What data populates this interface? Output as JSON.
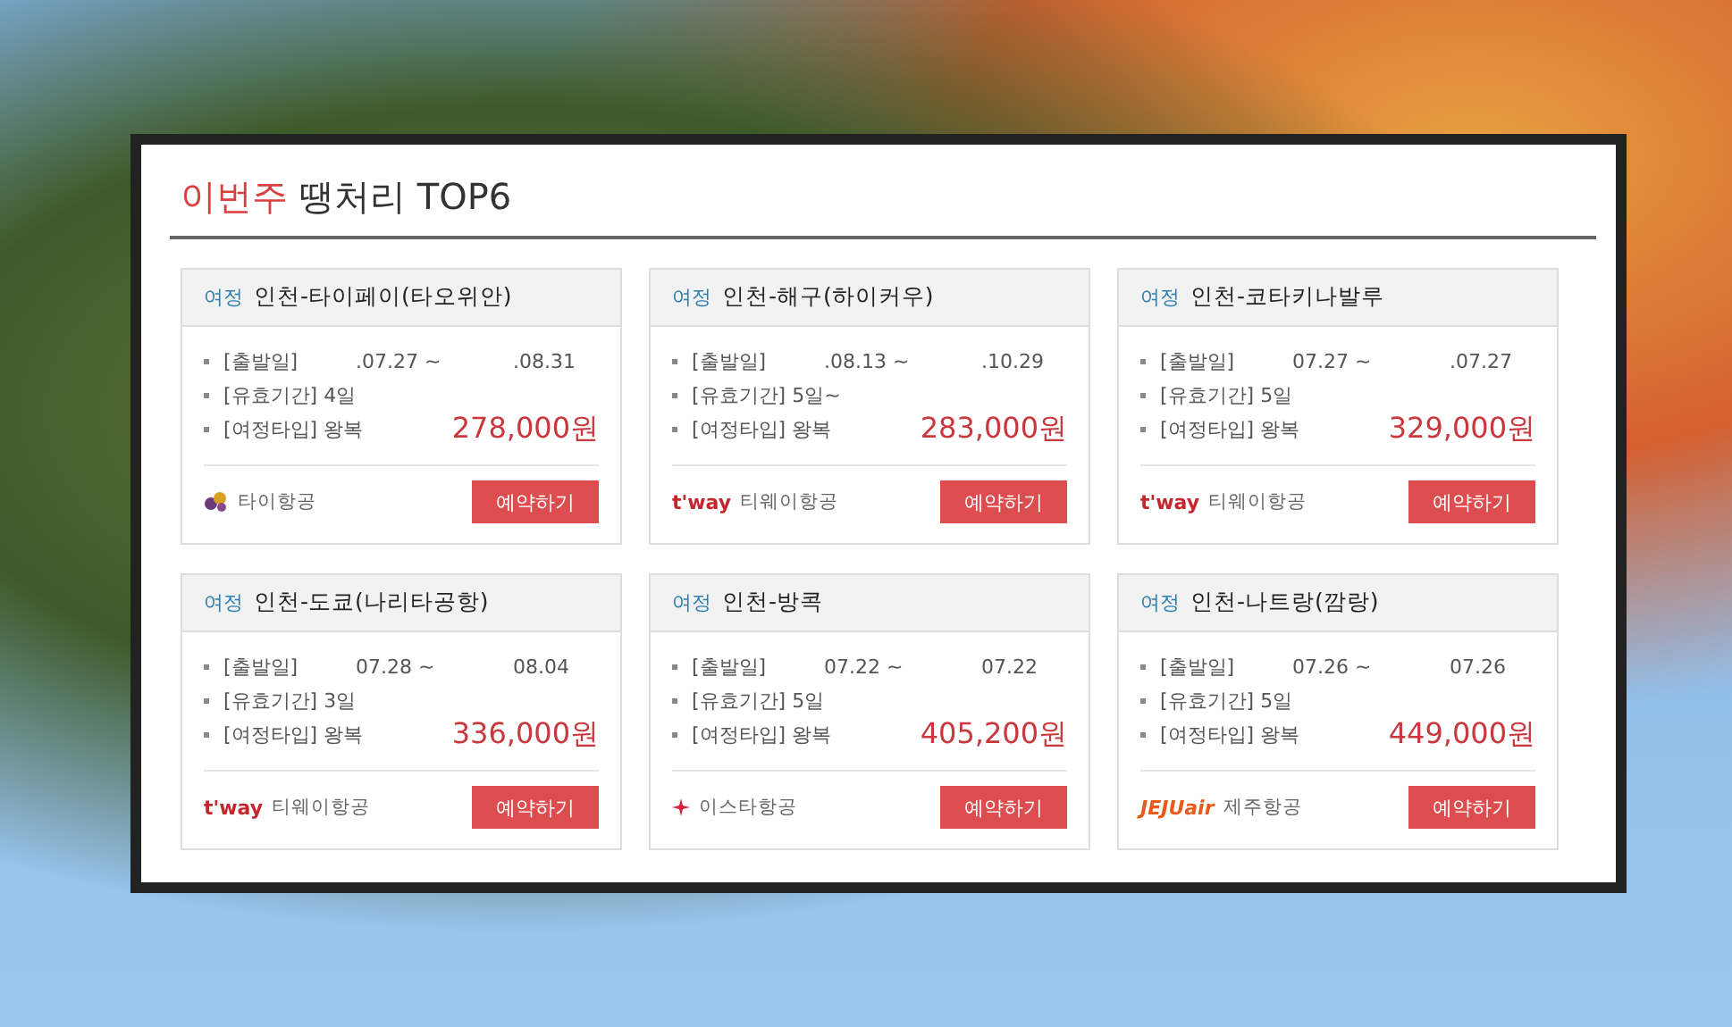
{
  "title": {
    "highlight": "이번주",
    "rest": "땡처리 TOP6"
  },
  "cards": [
    {
      "tag": "여정",
      "route": "인천-타이페이(타오위안)",
      "depart_label": "[출발일]",
      "depart_from": ".07.27 ~",
      "depart_to": ".08.31",
      "valid": "[유효기간] 4일",
      "trip": "[여정타입] 왕복",
      "price": "278,000원",
      "airline": {
        "kind": "thai",
        "name": "타이항공"
      },
      "button": "예약하기"
    },
    {
      "tag": "여정",
      "route": "인천-해구(하이커우)",
      "depart_label": "[출발일]",
      "depart_from": ".08.13 ~",
      "depart_to": ".10.29",
      "valid": "[유효기간] 5일~",
      "trip": "[여정타입] 왕복",
      "price": "283,000원",
      "airline": {
        "kind": "tway",
        "logo": "t'way",
        "name": "티웨이항공"
      },
      "button": "예약하기"
    },
    {
      "tag": "여정",
      "route": "인천-코타키나발루",
      "depart_label": "[출발일]",
      "depart_from": "07.27 ~",
      "depart_to": ".07.27",
      "valid": "[유효기간] 5일",
      "trip": "[여정타입] 왕복",
      "price": "329,000원",
      "airline": {
        "kind": "tway",
        "logo": "t'way",
        "name": "티웨이항공"
      },
      "button": "예약하기"
    },
    {
      "tag": "여정",
      "route": "인천-도쿄(나리타공항)",
      "depart_label": "[출발일]",
      "depart_from": "07.28 ~",
      "depart_to": "08.04",
      "valid": "[유효기간] 3일",
      "trip": "[여정타입] 왕복",
      "price": "336,000원",
      "airline": {
        "kind": "tway",
        "logo": "t'way",
        "name": "티웨이항공"
      },
      "button": "예약하기"
    },
    {
      "tag": "여정",
      "route": "인천-방콕",
      "depart_label": "[출발일]",
      "depart_from": "07.22 ~",
      "depart_to": "07.22",
      "valid": "[유효기간] 5일",
      "trip": "[여정타입] 왕복",
      "price": "405,200원",
      "airline": {
        "kind": "eastar",
        "name": "이스타항공"
      },
      "button": "예약하기"
    },
    {
      "tag": "여정",
      "route": "인천-나트랑(깜랑)",
      "depart_label": "[출발일]",
      "depart_from": "07.26 ~",
      "depart_to": "07.26",
      "valid": "[유효기간] 5일",
      "trip": "[여정타입] 왕복",
      "price": "449,000원",
      "airline": {
        "kind": "jeju",
        "logo": "JEJUair",
        "name": "제주항공"
      },
      "button": "예약하기"
    }
  ]
}
